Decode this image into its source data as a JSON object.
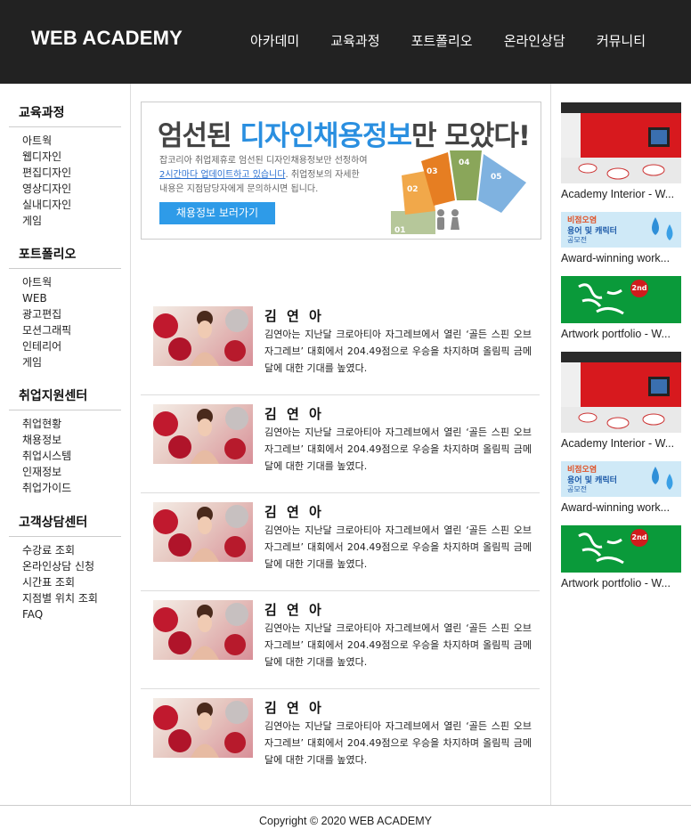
{
  "header": {
    "logo": "WEB ACADEMY",
    "nav": [
      "아카데미",
      "교육과정",
      "포트폴리오",
      "온라인상담",
      "커뮤니티"
    ]
  },
  "sidebar": {
    "groups": [
      {
        "title": "교육과정",
        "items": [
          "아트웍",
          "웹디자인",
          "편집디자인",
          "영상디자인",
          "실내디자인",
          "게임"
        ]
      },
      {
        "title": "포트폴리오",
        "items": [
          "아트웍",
          "WEB",
          "광고편집",
          "모션그래픽",
          "인테리어",
          "게임"
        ]
      },
      {
        "title": "취업지원센터",
        "items": [
          "취업현황",
          "채용정보",
          "취업시스템",
          "인재정보",
          "취업가이드"
        ]
      },
      {
        "title": "고객상담센터",
        "items": [
          "수강료 조회",
          "온라인상담 신청",
          "시간표 조회",
          "지점별 위치 조회",
          "FAQ"
        ]
      }
    ]
  },
  "banner": {
    "headline_pre": "엄선된 ",
    "headline_highlight": "디자인채용정보",
    "headline_post": "만 모았다!",
    "copy_line1": "잡코리아 취업제휴로 엄선된 디자인채용정보만 선정하여",
    "copy_line2_link": "2시간마다 업데이트하고 있습니다",
    "copy_line2_rest": ". 취업정보의 자세한",
    "copy_line3": "내용은 지점담당자에게 문의하시면 됩니다.",
    "button": "채용정보 보러가기",
    "steps": [
      "01",
      "02",
      "03",
      "04",
      "05"
    ]
  },
  "articles": [
    {
      "name": "김 연 아",
      "text": "김연아는 지난달 크로아티아 자그레브에서 열린 ‘골든 스핀 오브 자그레브’ 대회에서 204.49점으로 우승을 차지하며 올림픽 금메달에 대한 기대를 높였다."
    },
    {
      "name": "김 연 아",
      "text": "김연아는 지난달 크로아티아 자그레브에서 열린 ‘골든 스핀 오브 자그레브’ 대회에서 204.49점으로 우승을 차지하며 올림픽 금메달에 대한 기대를 높였다."
    },
    {
      "name": "김 연 아",
      "text": "김연아는 지난달 크로아티아 자그레브에서 열린 ‘골든 스핀 오브 자그레브’ 대회에서 204.49점으로 우승을 차지하며 올림픽 금메달에 대한 기대를 높였다."
    },
    {
      "name": "김 연 아",
      "text": "김연아는 지난달 크로아티아 자그레브에서 열린 ‘골든 스핀 오브 자그레브’ 대회에서 204.49점으로 우승을 차지하며 올림픽 금메달에 대한 기대를 높였다."
    },
    {
      "name": "김 연 아",
      "text": "김연아는 지난달 크로아티아 자그레브에서 열린 ‘골든 스핀 오브 자그레브’ 대회에서 204.49점으로 우승을 차지하며 올림픽 금메달에 대한 기대를 높였다."
    }
  ],
  "right": {
    "items": [
      {
        "caption": "Academy Interior - W...",
        "kind": "interior"
      },
      {
        "caption": "Award-winning work...",
        "kind": "award",
        "img_text1": "비점오염",
        "img_text2": "용어 및 캐릭터",
        "img_text3": "공모전"
      },
      {
        "caption": "Artwork portfolio - W...",
        "kind": "artwork",
        "img_text1": "2nd"
      },
      {
        "caption": "Academy Interior - W...",
        "kind": "interior"
      },
      {
        "caption": "Award-winning work...",
        "kind": "award",
        "img_text1": "비점오염",
        "img_text2": "용어 및 캐릭터",
        "img_text3": "공모전"
      },
      {
        "caption": "Artwork portfolio - W...",
        "kind": "artwork",
        "img_text1": "2nd"
      }
    ]
  },
  "footer": {
    "copyright": "Copyright © 2020 WEB ACADEMY"
  },
  "colors": {
    "header_bg": "#222222",
    "accent_blue": "#2e9be8",
    "interior_red": "#d7191e",
    "artwork_green": "#0a9a3a",
    "award_sky": "#cfe9f7"
  }
}
